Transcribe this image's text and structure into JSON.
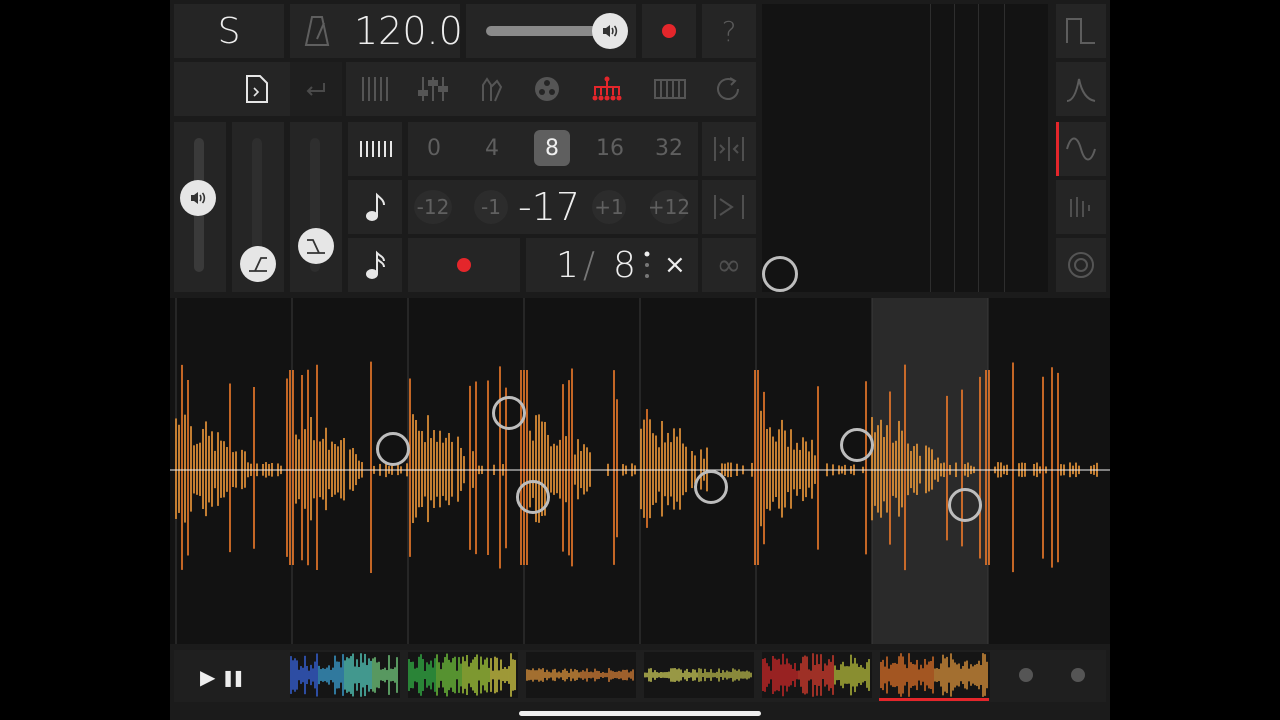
{
  "header": {
    "solo_label": "S",
    "tempo": "120.0",
    "volume_level": 0.78,
    "help_label": "?"
  },
  "grid": {
    "quantize_options": [
      "0",
      "4",
      "8",
      "16",
      "32"
    ],
    "quantize_selected": "8",
    "transpose_options": [
      "-12",
      "-1",
      "+1",
      "+12"
    ],
    "transpose_value": "-17",
    "length_numerator": "1",
    "length_denominator": "8",
    "multiply_symbol": "×",
    "infinity_symbol": "∞"
  },
  "colors": {
    "accent_red": "#e4262b",
    "wave_orange": "#f07b2a",
    "wave_yellow": "#f3c24f",
    "panel": "#252525"
  },
  "icons": [
    "metronome-icon",
    "speaker-icon",
    "record-dot-icon",
    "file-icon",
    "return-icon",
    "slices-icon",
    "mixer-icon",
    "hand-icon",
    "reel-icon",
    "tree-icon",
    "keyboard-icon",
    "loop-icon",
    "envelope-icon",
    "note-icon",
    "sixteenth-note-icon",
    "square-wave-icon",
    "ramp-wave-icon",
    "sine-wave-icon",
    "bars-icon",
    "target-icon",
    "play-icon",
    "pause-icon"
  ],
  "transport": {
    "play_symbol": "▶",
    "pause_symbol": "❚❚"
  },
  "patterns": [
    "pattern-1",
    "pattern-2",
    "pattern-3",
    "pattern-4",
    "pattern-5",
    "pattern-6"
  ]
}
